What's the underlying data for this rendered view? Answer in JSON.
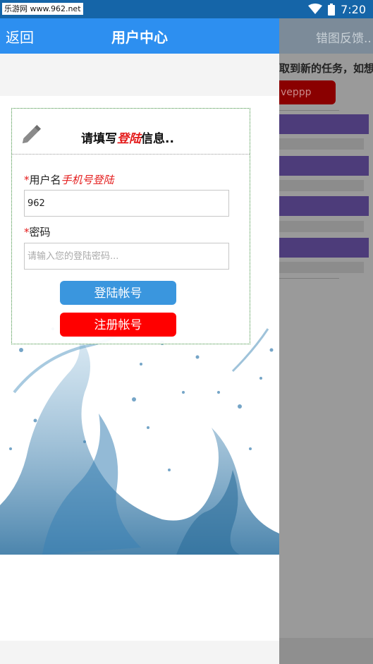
{
  "status_bar": {
    "watermark": "乐游网 www.962.net",
    "time": "7:20"
  },
  "background_page": {
    "feedback_label": "错图反馈..",
    "notice_text": "取到新的任务，如想",
    "red_button_text": "veppp"
  },
  "app_bar": {
    "back_label": "返回",
    "title": "用户中心"
  },
  "login_card": {
    "title_prefix": "请填写",
    "title_highlight": "登陆",
    "title_suffix": "信息..",
    "username": {
      "required_mark": "*",
      "label": "用户名",
      "hint": "手机号登陆",
      "value": "962"
    },
    "password": {
      "required_mark": "*",
      "label": "密码",
      "placeholder": "请输入您的登陆密码..."
    },
    "login_button": "登陆帐号",
    "register_button": "注册帐号"
  },
  "colors": {
    "app_bar": "#2d8ff0",
    "login_button": "#3a96de",
    "register_button": "#ff0000",
    "highlight_text": "#e41b1b"
  }
}
